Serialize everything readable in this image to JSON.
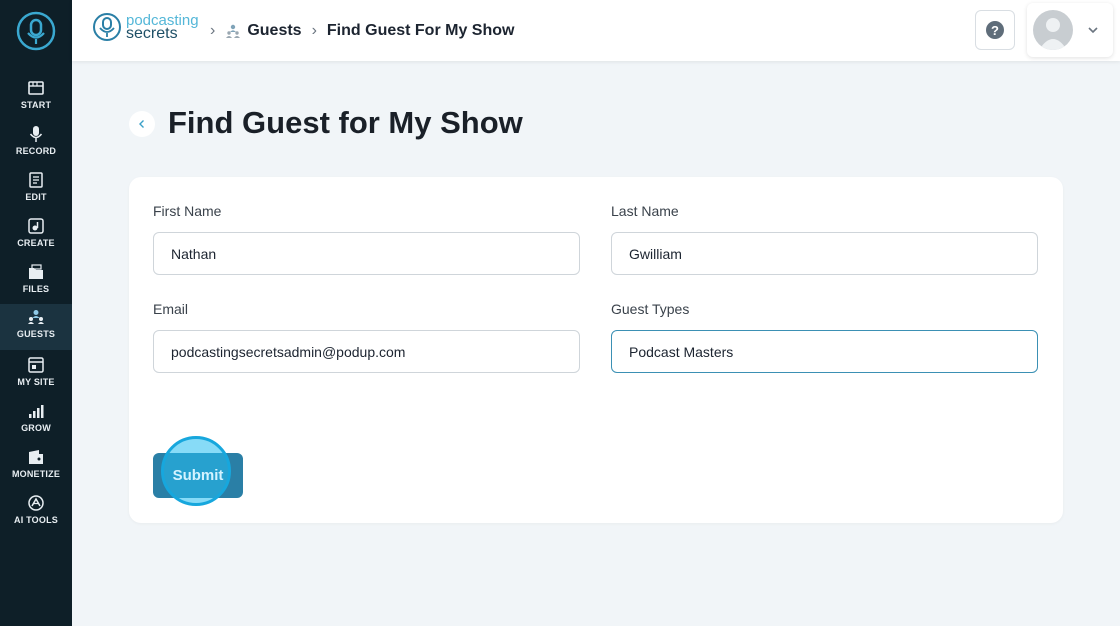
{
  "sidebar": {
    "items": [
      {
        "label": "START",
        "icon": "film-icon"
      },
      {
        "label": "RECORD",
        "icon": "microphone-icon"
      },
      {
        "label": "EDIT",
        "icon": "edit-icon"
      },
      {
        "label": "CREATE",
        "icon": "create-icon"
      },
      {
        "label": "FILES",
        "icon": "files-icon"
      },
      {
        "label": "GUESTS",
        "icon": "guests-icon"
      },
      {
        "label": "MY SITE",
        "icon": "site-icon"
      },
      {
        "label": "GROW",
        "icon": "grow-icon"
      },
      {
        "label": "MONETIZE",
        "icon": "monetize-icon"
      },
      {
        "label": "AI TOOLS",
        "icon": "ai-tools-icon"
      }
    ],
    "active": "GUESTS"
  },
  "header": {
    "brand_line1": "podcasting",
    "brand_line2": "secrets",
    "breadcrumb": [
      "Guests",
      "Find Guest For My Show"
    ],
    "help_label": "?"
  },
  "page": {
    "title": "Find Guest for My Show"
  },
  "form": {
    "first_name_label": "First Name",
    "first_name_value": "Nathan",
    "last_name_label": "Last Name",
    "last_name_value": "Gwilliam",
    "email_label": "Email",
    "email_value": "podcastingsecretsadmin@podup.com",
    "guest_types_label": "Guest Types",
    "guest_types_value": "Podcast Masters",
    "submit_label": "Submit"
  },
  "colors": {
    "sidebar_bg": "#0e1f28",
    "accent": "#2a7fa6",
    "click_highlight": "#17a7dd"
  }
}
